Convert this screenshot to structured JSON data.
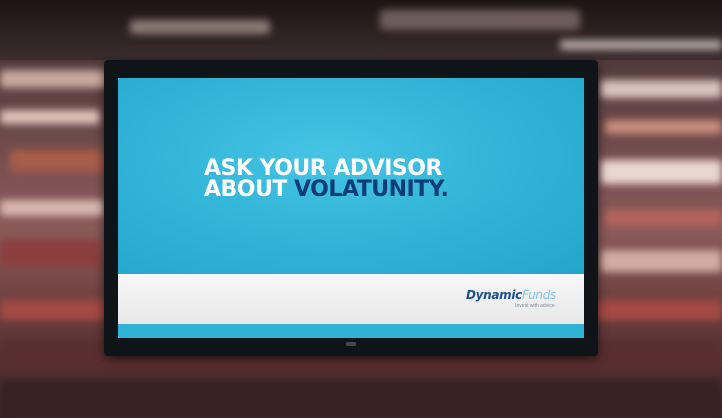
{
  "screen": {
    "headline_line1": "ASK YOUR ADVISOR",
    "headline_line2_white": "ABOUT ",
    "headline_line2_accent": "VOLATUNITY."
  },
  "logo": {
    "brand_bold": "Dynamic",
    "brand_light": "Funds",
    "tagline": "Invest with advice."
  },
  "colors": {
    "screen_blue": "#2fb2d6",
    "headline_white": "#ffffff",
    "headline_accent": "#0c3d7a",
    "logo_dark": "#1d4f8f",
    "logo_light": "#7fc3e6"
  }
}
